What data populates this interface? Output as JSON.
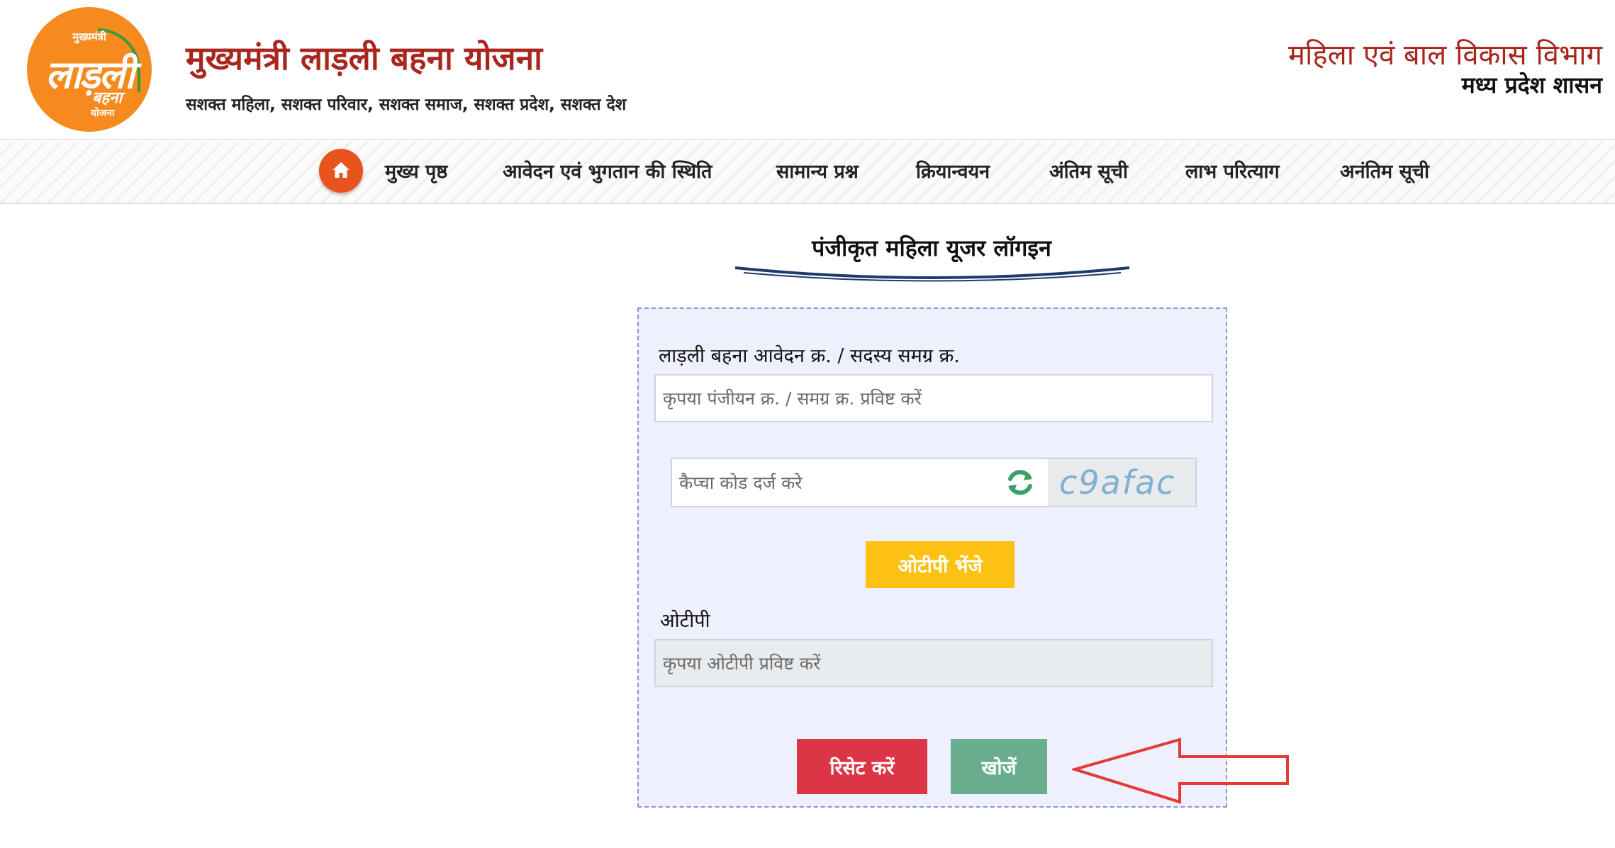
{
  "header": {
    "logo": {
      "top_text": "मुख्यमंत्री",
      "main_text": "लाड़ली",
      "sub_text_1": "बहना",
      "sub_text_2": "योजना"
    },
    "title": "मुख्यमंत्री लाड़ली बहना योजना",
    "tagline": "सशक्त महिला, सशक्त परिवार, सशक्त समाज, सशक्त प्रदेश, सशक्त देश",
    "department": "महिला एवं बाल विकास विभाग",
    "government": "मध्य प्रदेश शासन"
  },
  "nav": {
    "items": [
      {
        "label": "मुख्य पृष्ठ"
      },
      {
        "label": "आवेदन एवं भुगतान की स्थिति"
      },
      {
        "label": "सामान्य प्रश्न"
      },
      {
        "label": "क्रियान्वयन"
      },
      {
        "label": "अंतिम सूची"
      },
      {
        "label": "लाभ परित्याग"
      },
      {
        "label": "अनंतिम सूची"
      }
    ]
  },
  "form": {
    "title": "पंजीकृत महिला यूजर लॉगइन",
    "registration": {
      "label": "लाड़ली बहना आवेदन क्र. / सदस्य समग्र क्र.",
      "value": "",
      "placeholder": "कृपया पंजीयन क्र. / समग्र क्र. प्रविष्ट करें"
    },
    "captcha": {
      "value": "",
      "placeholder": "कैप्चा कोड दर्ज करे",
      "code": "c9afac"
    },
    "send_otp_label": "ओटीपी भेंजे",
    "otp": {
      "label": "ओटीपी",
      "value": "",
      "placeholder": "कृपया ओटीपी प्रविष्ट करें"
    },
    "reset_label": "रिसेट करें",
    "search_label": "खोजें"
  },
  "colors": {
    "brand_red": "#a8261e",
    "home_orange": "#e9531d",
    "otp_button": "#fdc114",
    "reset_button": "#dc3545",
    "search_button": "#6aad8d",
    "annotation_arrow": "#e53935"
  }
}
